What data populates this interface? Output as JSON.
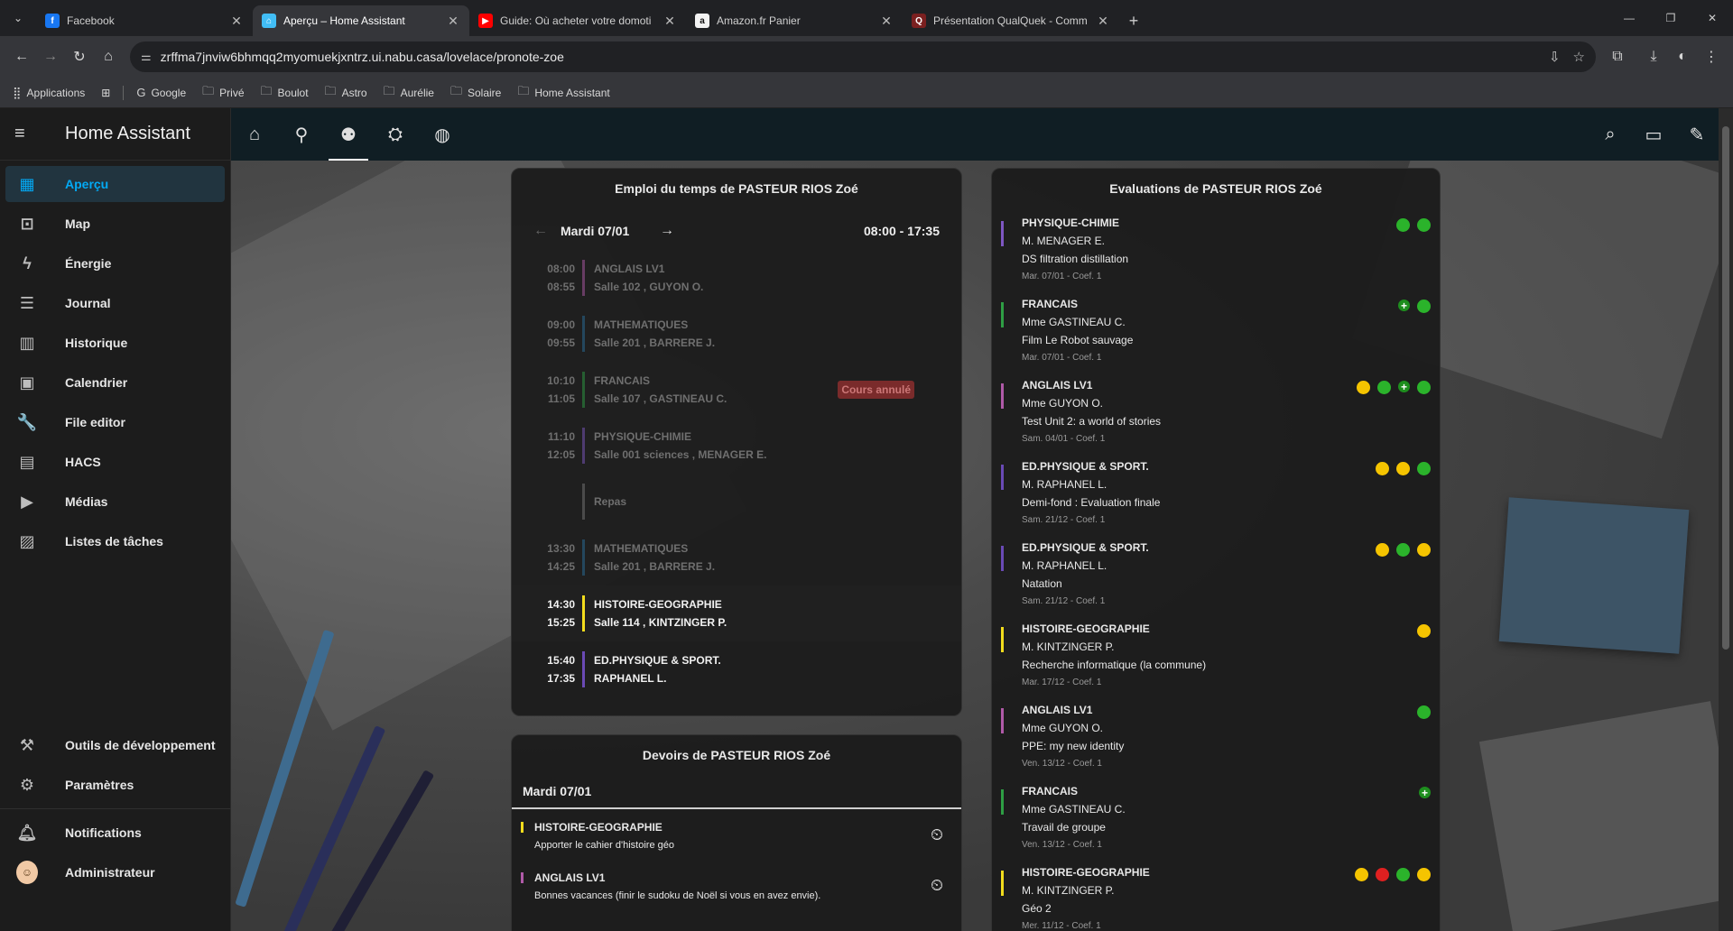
{
  "browser": {
    "tabs": [
      {
        "label": "Facebook",
        "favicon": "facebook-icon",
        "color": "#1877f2",
        "glyph": "f"
      },
      {
        "label": "Aperçu – Home Assistant",
        "favicon": "home-assistant-icon",
        "color": "#41bdf5",
        "glyph": "⌂"
      },
      {
        "label": "Guide: Où acheter votre domoti",
        "favicon": "youtube-icon",
        "color": "#ff0000",
        "glyph": "▶"
      },
      {
        "label": "Amazon.fr Panier",
        "favicon": "amazon-icon",
        "color": "#f3f3f3",
        "glyph": "a"
      },
      {
        "label": "Présentation QualQuek - Comm",
        "favicon": "forum-icon",
        "color": "#7b2020",
        "glyph": "Q"
      }
    ],
    "url": "zrffma7jnviw6bhmqq2myomuekjxntrz.ui.nabu.casa/lovelace/pronote-zoe",
    "bookmarks": [
      {
        "label": "Applications",
        "icon": "apps-grid-icon"
      },
      {
        "label": "Google",
        "icon": "google-icon"
      },
      {
        "label": "Privé",
        "icon": "folder-icon"
      },
      {
        "label": "Boulot",
        "icon": "folder-icon"
      },
      {
        "label": "Astro",
        "icon": "folder-icon"
      },
      {
        "label": "Aurélie",
        "icon": "folder-icon"
      },
      {
        "label": "Solaire",
        "icon": "folder-icon"
      },
      {
        "label": "Home Assistant",
        "icon": "folder-icon"
      }
    ]
  },
  "sidebar": {
    "title": "Home Assistant",
    "items": [
      {
        "label": "Aperçu",
        "icon": "dashboard-icon",
        "glyph": "▦",
        "active": true
      },
      {
        "label": "Map",
        "icon": "map-icon",
        "glyph": "⊡"
      },
      {
        "label": "Énergie",
        "icon": "lightning-icon",
        "glyph": "ϟ"
      },
      {
        "label": "Journal",
        "icon": "list-icon",
        "glyph": "☰"
      },
      {
        "label": "Historique",
        "icon": "chart-icon",
        "glyph": "▥"
      },
      {
        "label": "Calendrier",
        "icon": "calendar-icon",
        "glyph": "▣"
      },
      {
        "label": "File editor",
        "icon": "wrench-icon",
        "glyph": "🔧"
      },
      {
        "label": "HACS",
        "icon": "hacs-icon",
        "glyph": "▤"
      },
      {
        "label": "Médias",
        "icon": "media-icon",
        "glyph": "▶"
      },
      {
        "label": "Listes de tâches",
        "icon": "clipboard-icon",
        "glyph": "▨"
      }
    ],
    "bottom_items": [
      {
        "label": "Outils de développement",
        "icon": "hammer-icon",
        "glyph": "⚒"
      },
      {
        "label": "Paramètres",
        "icon": "gear-icon",
        "glyph": "⚙"
      }
    ],
    "notifications": "Notifications",
    "user": "Administrateur"
  },
  "colors": {
    "accent": "#03a9f4",
    "topbar": "#101e24",
    "physique": "#7e57c2",
    "francais": "#2e9e44",
    "anglais": "#b05aa8",
    "eps": "#6a4ab5",
    "histoire": "#f2dc1d",
    "maths": "#2a6f9b",
    "dot_green": "#2bb32b",
    "dot_yellow": "#f5c400",
    "dot_red": "#e02020",
    "dot_plus": "#1e8e1e"
  },
  "timetable": {
    "title": "Emploi du temps de PASTEUR RIOS Zoé",
    "prev": "←",
    "next": "→",
    "day": "Mardi 07/01",
    "hours": "08:00 - 17:35",
    "lessons": [
      {
        "start": "08:00",
        "end": "08:55",
        "subject": "ANGLAIS LV1",
        "room": "Salle 102 , GUYON O.",
        "state": "past",
        "color": "#b05aa8"
      },
      {
        "start": "09:00",
        "end": "09:55",
        "subject": "MATHEMATIQUES",
        "room": "Salle 201 , BARRERE J.",
        "state": "past",
        "color": "#2a6f9b"
      },
      {
        "start": "10:10",
        "end": "11:05",
        "subject": "FRANCAIS",
        "room": "Salle 107 , GASTINEAU C.",
        "state": "past",
        "color": "#2e9e44",
        "badge": "Cours annulé"
      },
      {
        "start": "11:10",
        "end": "12:05",
        "subject": "PHYSIQUE-CHIMIE",
        "room": "Salle 001 sciences , MENAGER E.",
        "state": "past",
        "color": "#7e57c2"
      },
      {
        "start": "",
        "end": "",
        "subject": "Repas",
        "room": "",
        "state": "past",
        "color": "#777777"
      },
      {
        "start": "13:30",
        "end": "14:25",
        "subject": "MATHEMATIQUES",
        "room": "Salle 201 , BARRERE J.",
        "state": "past",
        "color": "#2a6f9b"
      },
      {
        "start": "14:30",
        "end": "15:25",
        "subject": "HISTOIRE-GEOGRAPHIE",
        "room": "Salle 114 , KINTZINGER P.",
        "state": "current",
        "color": "#f2dc1d"
      },
      {
        "start": "15:40",
        "end": "17:35",
        "subject": "ED.PHYSIQUE & SPORT.",
        "room": "RAPHANEL L.",
        "state": "future",
        "color": "#6a4ab5"
      }
    ]
  },
  "homework": {
    "title": "Devoirs de PASTEUR RIOS Zoé",
    "day": "Mardi 07/01",
    "items": [
      {
        "subject": "HISTOIRE-GEOGRAPHIE",
        "desc": "Apporter le cahier d'histoire géo",
        "color": "#f2dc1d"
      },
      {
        "subject": "ANGLAIS LV1",
        "desc": "Bonnes vacances (finir le sudoku de Noël si vous en avez envie).",
        "color": "#b05aa8"
      }
    ]
  },
  "evaluations": {
    "title": "Evaluations de PASTEUR RIOS Zoé",
    "items": [
      {
        "subject": "PHYSIQUE-CHIMIE",
        "teacher": "M. MENAGER E.",
        "name": "DS filtration distillation",
        "meta": "Mar. 07/01 - Coef. 1",
        "color": "#7e57c2",
        "dots": [
          "green",
          "green"
        ]
      },
      {
        "subject": "FRANCAIS",
        "teacher": "Mme GASTINEAU C.",
        "name": "Film Le Robot sauvage",
        "meta": "Mar. 07/01 - Coef. 1",
        "color": "#2e9e44",
        "dots": [
          "plus",
          "green"
        ]
      },
      {
        "subject": "ANGLAIS LV1",
        "teacher": "Mme GUYON O.",
        "name": "Test Unit 2: a world of stories",
        "meta": "Sam. 04/01 - Coef. 1",
        "color": "#b05aa8",
        "dots": [
          "yellow",
          "green",
          "plus",
          "green"
        ]
      },
      {
        "subject": "ED.PHYSIQUE & SPORT.",
        "teacher": "M. RAPHANEL L.",
        "name": "Demi-fond : Evaluation finale",
        "meta": "Sam. 21/12 - Coef. 1",
        "color": "#6a4ab5",
        "dots": [
          "yellow",
          "yellow",
          "green"
        ]
      },
      {
        "subject": "ED.PHYSIQUE & SPORT.",
        "teacher": "M. RAPHANEL L.",
        "name": "Natation",
        "meta": "Sam. 21/12 - Coef. 1",
        "color": "#6a4ab5",
        "dots": [
          "yellow",
          "green",
          "yellow"
        ]
      },
      {
        "subject": "HISTOIRE-GEOGRAPHIE",
        "teacher": "M. KINTZINGER P.",
        "name": "Recherche informatique (la commune)",
        "meta": "Mar. 17/12 - Coef. 1",
        "color": "#f2dc1d",
        "dots": [
          "yellow"
        ]
      },
      {
        "subject": "ANGLAIS LV1",
        "teacher": "Mme GUYON O.",
        "name": "PPE: my new identity",
        "meta": "Ven. 13/12 - Coef. 1",
        "color": "#b05aa8",
        "dots": [
          "green"
        ]
      },
      {
        "subject": "FRANCAIS",
        "teacher": "Mme GASTINEAU C.",
        "name": "Travail de groupe",
        "meta": "Ven. 13/12 - Coef. 1",
        "color": "#2e9e44",
        "dots": [
          "plus"
        ]
      },
      {
        "subject": "HISTOIRE-GEOGRAPHIE",
        "teacher": "M. KINTZINGER P.",
        "name": "Géo 2",
        "meta": "Mer. 11/12 - Coef. 1",
        "color": "#f2dc1d",
        "dots": [
          "yellow",
          "red",
          "green",
          "yellow"
        ]
      }
    ]
  }
}
